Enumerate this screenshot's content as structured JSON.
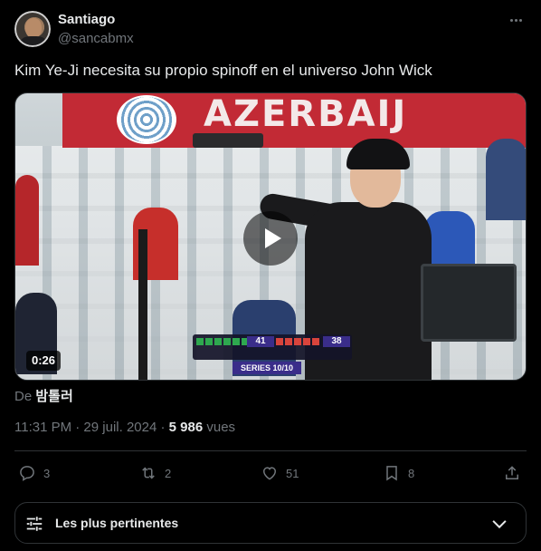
{
  "tweet": {
    "author_name": "Santiago",
    "author_handle": "@sancabmx",
    "text": "Kim Ye-Ji necesita su propio spinoff en el universo John Wick",
    "media": {
      "banner_text": "AZERBAIJ",
      "duration": "0:26",
      "score_left": "41",
      "score_right": "38",
      "series_label": "SERIES 10/10"
    },
    "source_prefix": "De",
    "source_name": "밤톨러",
    "timestamp": "11:31 PM · 29 juil. 2024 · ",
    "views_count": "5 986",
    "views_label": " vues"
  },
  "actions": {
    "replies": "3",
    "reposts": "2",
    "likes": "51",
    "bookmarks": "8"
  },
  "sort": {
    "label": "Les plus pertinentes"
  },
  "colors": {
    "background": "#000000",
    "text_primary": "#e7e9ea",
    "text_secondary": "#71767b",
    "border": "#2f3336"
  }
}
